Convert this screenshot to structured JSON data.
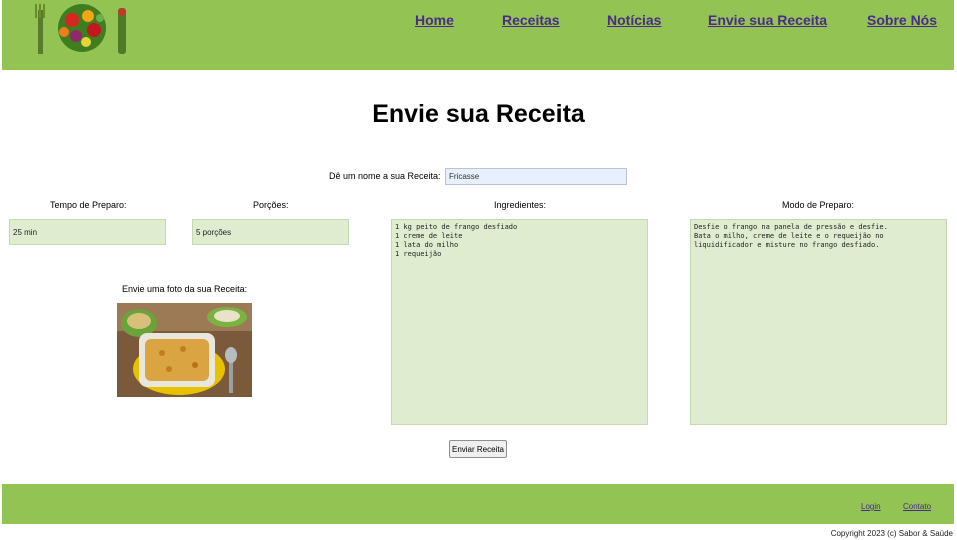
{
  "nav": {
    "home": "Home",
    "recipes": "Receitas",
    "news": "Notícias",
    "submit_recipe": "Envie sua Receita",
    "about": "Sobre Nós"
  },
  "page_title": "Envie sua Receita",
  "form": {
    "name_label": "Dê um nome a sua Receita:",
    "name_value": "Fricasse",
    "prep_time_label": "Tempo de Preparo:",
    "prep_time_value": "25 min",
    "servings_label": "Porções:",
    "servings_value": "5 porções",
    "ingredients_label": "Ingredientes:",
    "ingredients_value": "1 kg peito de frango desfiado\n1 creme de leite\n1 lata do milho\n1 requeijão",
    "method_label": "Modo de Preparo:",
    "method_value": "Desfie o frango na panela de pressão e desfie.\nBata o milho, creme de leite e o requeijão no liquidificador e misture no frango desfiado.",
    "photo_label": "Envie uma foto da sua Receita:",
    "submit_label": "Enviar Receita"
  },
  "footer": {
    "login": "Login",
    "contact": "Contato",
    "copyright": "Copyright 2023 (c) Sabor & Saúde"
  },
  "colors": {
    "header_green": "#92c353",
    "field_green": "#dfecd0",
    "link_purple": "#4b2b8a"
  }
}
